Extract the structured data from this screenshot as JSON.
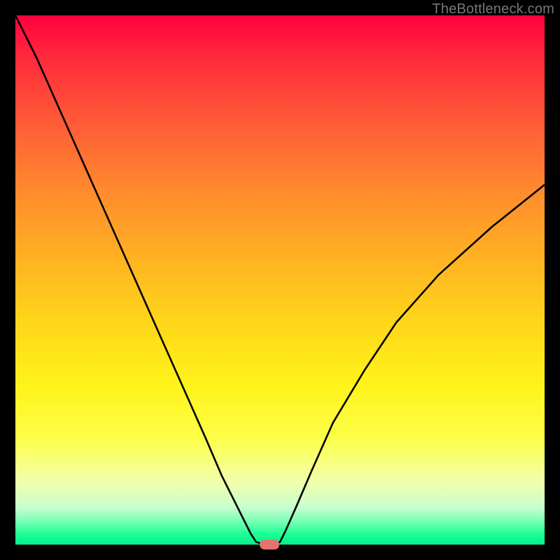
{
  "watermark": "TheBottleneck.com",
  "chart_data": {
    "type": "line",
    "title": "",
    "xlabel": "",
    "ylabel": "",
    "xlim": [
      0,
      100
    ],
    "ylim": [
      0,
      100
    ],
    "grid": false,
    "series": [
      {
        "name": "curve",
        "x": [
          0,
          4,
          8,
          12,
          16,
          20,
          24,
          28,
          32,
          36,
          39,
          41,
          43,
          44.5,
          45.5,
          47,
          49,
          50,
          51,
          53,
          56,
          60,
          66,
          72,
          80,
          90,
          100
        ],
        "y": [
          100,
          92,
          83,
          74,
          65,
          56,
          47,
          38,
          29,
          20,
          13,
          9,
          5,
          2,
          0.5,
          0,
          0,
          0.5,
          2.5,
          7,
          14,
          23,
          33,
          42,
          51,
          60,
          68
        ]
      }
    ],
    "marker": {
      "x_pct": 48.0,
      "y_pct": 0.0,
      "color": "#e4736c"
    },
    "curve_stroke": "#000000",
    "curve_width": 2.6
  }
}
